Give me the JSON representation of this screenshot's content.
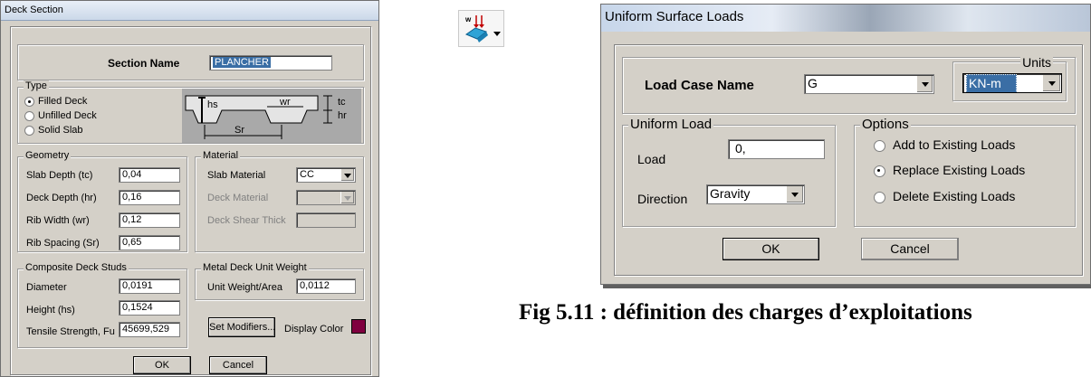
{
  "deck_section": {
    "title": "Deck Section",
    "section_name_label": "Section Name",
    "section_name_value": "PLANCHER",
    "type_group": "Type",
    "type_options": [
      "Filled Deck",
      "Unfilled Deck",
      "Solid Slab"
    ],
    "type_selected": "Filled Deck",
    "diagram_labels": {
      "hs": "hs",
      "wr": "wr",
      "tc": "tc",
      "hr": "hr",
      "sr": "Sr"
    },
    "geometry_group": "Geometry",
    "geometry": [
      {
        "label": "Slab Depth (tc)",
        "value": "0,04"
      },
      {
        "label": "Deck Depth (hr)",
        "value": "0,16"
      },
      {
        "label": "Rib Width (wr)",
        "value": "0,12"
      },
      {
        "label": "Rib Spacing (Sr)",
        "value": "0,65"
      }
    ],
    "material_group": "Material",
    "slab_material_label": "Slab Material",
    "slab_material_value": "CC",
    "deck_material_label": "Deck Material",
    "deck_shear_label": "Deck Shear Thick",
    "studs_group": "Composite Deck Studs",
    "studs": [
      {
        "label": "Diameter",
        "value": "0,0191"
      },
      {
        "label": "Height (hs)",
        "value": "0,1524"
      },
      {
        "label": "Tensile Strength, Fu",
        "value": "45699,529"
      }
    ],
    "unit_weight_group": "Metal Deck Unit Weight",
    "unit_weight_label": "Unit Weight/Area",
    "unit_weight_value": "0,0112",
    "set_modifiers_label": "Set Modifiers...",
    "display_color_label": "Display Color",
    "display_color": "#800040",
    "ok_label": "OK",
    "cancel_label": "Cancel"
  },
  "toolbar": {
    "icon": "assign-surface-load-icon"
  },
  "uniform_loads": {
    "title": "Uniform Surface Loads",
    "load_case_label": "Load Case Name",
    "load_case_value": "G",
    "units_group": "Units",
    "units_value": "KN-m",
    "uniform_load_group": "Uniform Load",
    "load_label": "Load",
    "load_value": "0,",
    "direction_label": "Direction",
    "direction_value": "Gravity",
    "options_group": "Options",
    "options": [
      "Add to Existing Loads",
      "Replace Existing Loads",
      "Delete Existing Loads"
    ],
    "option_selected": "Replace Existing Loads",
    "ok_label": "OK",
    "cancel_label": "Cancel"
  },
  "caption": "Fig 5.11 : définition des charges d’exploitations"
}
